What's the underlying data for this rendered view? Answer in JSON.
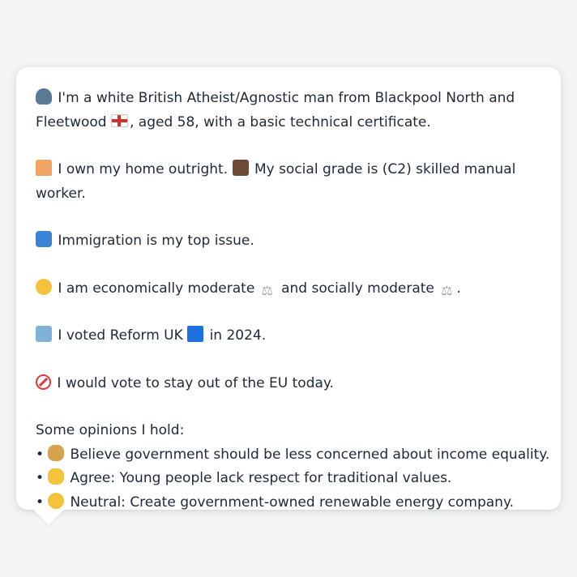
{
  "profile": {
    "p1": {
      "icon": "person-silhouette-icon",
      "text_a": "I'm a white British Atheist/Agnostic man from Blackpool North and Fleetwood",
      "flag_icon": "england-flag-icon",
      "text_b": ", aged 58, with a basic technical certificate."
    },
    "p2": {
      "icon_a": "house-icon",
      "text_a": "I own my home outright.",
      "icon_b": "briefcase-icon",
      "text_b": "My social grade is (C2) skilled manual worker."
    },
    "p3": {
      "icon": "passport-control-icon",
      "text": "Immigration is my top issue."
    },
    "p4": {
      "icon": "thinking-face-icon",
      "text_a": "I am economically moderate",
      "scales_a": "balance-scale-icon",
      "text_b": "and socially moderate",
      "scales_b": "balance-scale-icon",
      "text_c": "."
    },
    "p5": {
      "icon": "ballot-box-icon",
      "text_a": "I voted Reform UK",
      "square_icon": "blue-square-icon",
      "text_b": "in 2024."
    },
    "p6": {
      "icon": "no-entry-icon",
      "text": "I would vote to stay out of the EU today."
    },
    "opinions": {
      "header": "Some opinions I hold:",
      "items": [
        {
          "bullet": "•",
          "icon": "goblin-icon",
          "text": "Believe government should be less concerned about income equality."
        },
        {
          "bullet": "•",
          "icon": "thumbs-up-icon",
          "text": "Agree: Young people lack respect for traditional values."
        },
        {
          "bullet": "•",
          "icon": "neutral-face-icon",
          "text": "Neutral: Create government-owned renewable energy company."
        }
      ]
    }
  }
}
